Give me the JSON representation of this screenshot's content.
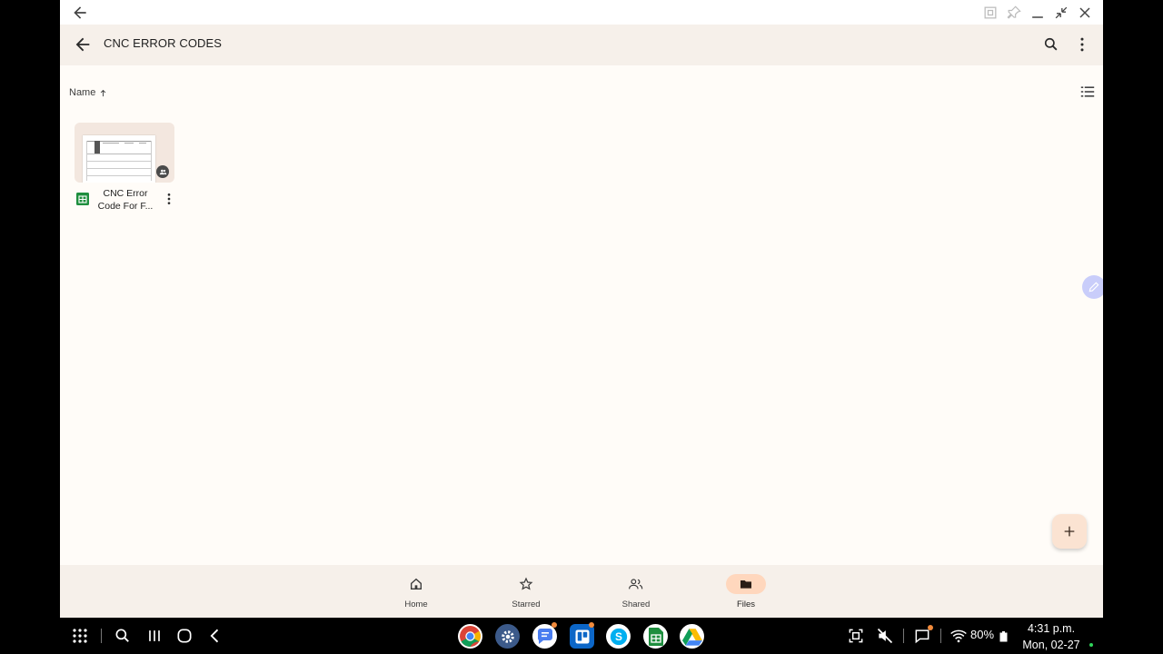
{
  "app": {
    "folder_title": "CNC ERROR CODES",
    "sort_label": "Name"
  },
  "files": [
    {
      "name": "CNC Error\nCode For F..."
    }
  ],
  "bottom_nav": {
    "items": [
      {
        "label": "Home",
        "icon": "home-icon"
      },
      {
        "label": "Starred",
        "icon": "star-icon"
      },
      {
        "label": "Shared",
        "icon": "people-icon"
      },
      {
        "label": "Files",
        "icon": "folder-icon",
        "active": true
      }
    ]
  },
  "status": {
    "battery": "80%",
    "time": "4:31 p.m.",
    "date": "Mon, 02-27"
  },
  "colors": {
    "app_background": "#fffcf8",
    "bar_background": "#f6f0ea",
    "active_nav_pill": "#ffd7bd",
    "sheets_green": "#1e8e3e"
  }
}
